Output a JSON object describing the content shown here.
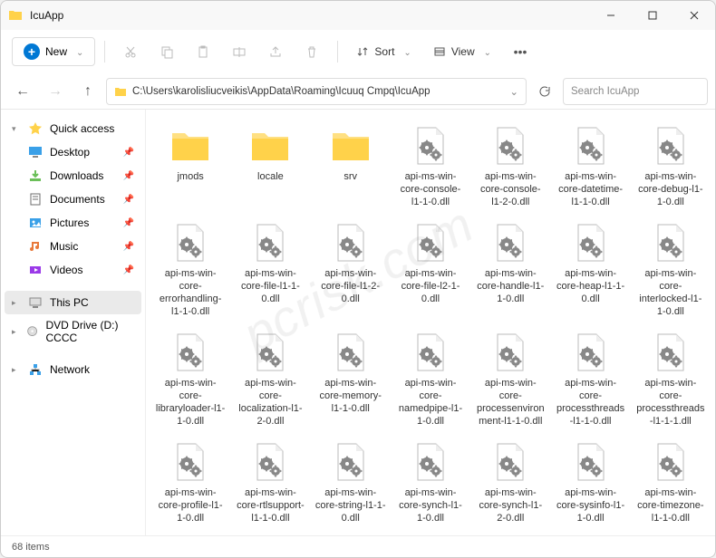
{
  "window": {
    "title": "IcuApp"
  },
  "toolbar": {
    "new_label": "New",
    "sort_label": "Sort",
    "view_label": "View"
  },
  "nav": {
    "path": "C:\\Users\\karolisliucveikis\\AppData\\Roaming\\Icuuq Cmpq\\IcuApp",
    "search_placeholder": "Search IcuApp"
  },
  "sidebar": {
    "items": [
      {
        "label": "Quick access",
        "icon": "star",
        "chev": "▾",
        "color": "#ffd24a"
      },
      {
        "label": "Desktop",
        "icon": "desktop",
        "pin": true,
        "color": "#3aa0e8"
      },
      {
        "label": "Downloads",
        "icon": "download",
        "pin": true,
        "color": "#6bbf59"
      },
      {
        "label": "Documents",
        "icon": "doc",
        "pin": true,
        "color": "#6d6d6d"
      },
      {
        "label": "Pictures",
        "icon": "pic",
        "pin": true,
        "color": "#3aa0e8"
      },
      {
        "label": "Music",
        "icon": "music",
        "pin": true,
        "color": "#e8793a"
      },
      {
        "label": "Videos",
        "icon": "video",
        "pin": true,
        "color": "#9b3ae8"
      },
      {
        "label": "This PC",
        "icon": "pc",
        "chev": "▸",
        "sel": true,
        "color": "#6d6d6d"
      },
      {
        "label": "DVD Drive (D:) CCCC",
        "icon": "dvd",
        "chev": "▸",
        "color": "#9aa0a6"
      },
      {
        "label": "Network",
        "icon": "net",
        "chev": "▸",
        "color": "#3aa0e8"
      }
    ]
  },
  "files": [
    {
      "name": "jmods",
      "type": "folder"
    },
    {
      "name": "locale",
      "type": "folder"
    },
    {
      "name": "srv",
      "type": "folder"
    },
    {
      "name": "api-ms-win-core-console-l1-1-0.dll",
      "type": "dll"
    },
    {
      "name": "api-ms-win-core-console-l1-2-0.dll",
      "type": "dll"
    },
    {
      "name": "api-ms-win-core-datetime-l1-1-0.dll",
      "type": "dll"
    },
    {
      "name": "api-ms-win-core-debug-l1-1-0.dll",
      "type": "dll"
    },
    {
      "name": "api-ms-win-core-errorhandling-l1-1-0.dll",
      "type": "dll"
    },
    {
      "name": "api-ms-win-core-file-l1-1-0.dll",
      "type": "dll"
    },
    {
      "name": "api-ms-win-core-file-l1-2-0.dll",
      "type": "dll"
    },
    {
      "name": "api-ms-win-core-file-l2-1-0.dll",
      "type": "dll"
    },
    {
      "name": "api-ms-win-core-handle-l1-1-0.dll",
      "type": "dll"
    },
    {
      "name": "api-ms-win-core-heap-l1-1-0.dll",
      "type": "dll"
    },
    {
      "name": "api-ms-win-core-interlocked-l1-1-0.dll",
      "type": "dll"
    },
    {
      "name": "api-ms-win-core-libraryloader-l1-1-0.dll",
      "type": "dll"
    },
    {
      "name": "api-ms-win-core-localization-l1-2-0.dll",
      "type": "dll"
    },
    {
      "name": "api-ms-win-core-memory-l1-1-0.dll",
      "type": "dll"
    },
    {
      "name": "api-ms-win-core-namedpipe-l1-1-0.dll",
      "type": "dll"
    },
    {
      "name": "api-ms-win-core-processenvironment-l1-1-0.dll",
      "type": "dll"
    },
    {
      "name": "api-ms-win-core-processthreads-l1-1-0.dll",
      "type": "dll"
    },
    {
      "name": "api-ms-win-core-processthreads-l1-1-1.dll",
      "type": "dll"
    },
    {
      "name": "api-ms-win-core-profile-l1-1-0.dll",
      "type": "dll"
    },
    {
      "name": "api-ms-win-core-rtlsupport-l1-1-0.dll",
      "type": "dll"
    },
    {
      "name": "api-ms-win-core-string-l1-1-0.dll",
      "type": "dll"
    },
    {
      "name": "api-ms-win-core-synch-l1-1-0.dll",
      "type": "dll"
    },
    {
      "name": "api-ms-win-core-synch-l1-2-0.dll",
      "type": "dll"
    },
    {
      "name": "api-ms-win-core-sysinfo-l1-1-0.dll",
      "type": "dll"
    },
    {
      "name": "api-ms-win-core-timezone-l1-1-0.dll",
      "type": "dll"
    }
  ],
  "status": {
    "count_label": "68 items"
  },
  "watermark": "pcrisk.com"
}
